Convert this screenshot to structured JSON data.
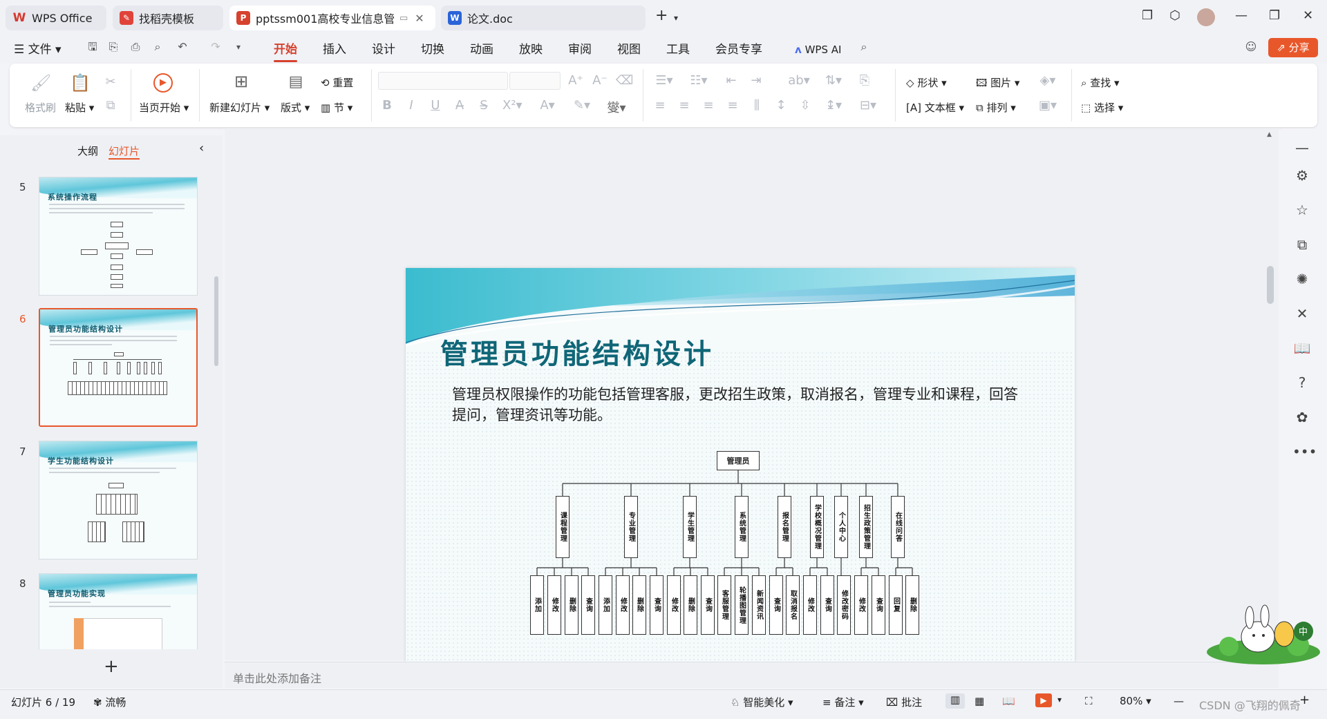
{
  "tabs": [
    {
      "label": "WPS Office",
      "icon": "wps-logo-icon",
      "color": "#d63a2f"
    },
    {
      "label": "找稻壳模板",
      "icon": "docer-icon",
      "color": "#e0433a"
    },
    {
      "label": "pptssm001高校专业信息管理",
      "icon": "ppt-icon",
      "color": "#d6422e"
    },
    {
      "label": "论文.doc",
      "icon": "word-icon",
      "color": "#2b64d8"
    }
  ],
  "menu": {
    "file": "文件",
    "items": [
      "开始",
      "插入",
      "设计",
      "切换",
      "动画",
      "放映",
      "审阅",
      "视图",
      "工具",
      "会员专享"
    ],
    "active": "开始",
    "wps_ai": "WPS AI",
    "share": "分享"
  },
  "ribbon": {
    "format_painter": "格式刷",
    "paste": "粘贴",
    "from_current": "当页开始",
    "new_slide": "新建幻灯片",
    "layout": "版式",
    "reset": "重置",
    "section": "节",
    "shape": "形状",
    "picture": "图片",
    "textbox": "文本框",
    "arrange": "排列",
    "find": "查找",
    "select": "选择"
  },
  "left_panel": {
    "tab_outline": "大纲",
    "tab_slides": "幻灯片",
    "slides": [
      {
        "num": "5",
        "title": "系统操作流程"
      },
      {
        "num": "6",
        "title": "管理员功能结构设计",
        "selected": true
      },
      {
        "num": "7",
        "title": "学生功能结构设计"
      },
      {
        "num": "8",
        "title": "管理员功能实现"
      }
    ]
  },
  "slide": {
    "title": "管理员功能结构设计",
    "body": "管理员权限操作的功能包括管理客服，更改招生政策，取消报名，管理专业和课程，回答提问，管理资讯等功能。",
    "root": "管理员",
    "modules": [
      "课程管理",
      "专业管理",
      "学生管理",
      "系统管理",
      "报名管理",
      "学校概况管理",
      "个人中心",
      "招生政策管理",
      "在线问答"
    ],
    "leaves": [
      "添加",
      "修改",
      "删除",
      "查询",
      "添加",
      "修改",
      "删除",
      "查询",
      "修改",
      "删除",
      "查询",
      "客服管理",
      "轮播图管理",
      "新闻资讯",
      "查询",
      "取消报名",
      "修改",
      "查询",
      "修改密码",
      "修改",
      "查询",
      "回复",
      "删除"
    ]
  },
  "notes_placeholder": "单击此处添加备注",
  "status": {
    "slide_pos": "幻灯片 6 / 19",
    "smooth": "流畅",
    "beautify": "智能美化",
    "notes": "备注",
    "comment": "批注",
    "zoom": "80%",
    "watermark": "CSDN @飞翔的佩奇"
  }
}
